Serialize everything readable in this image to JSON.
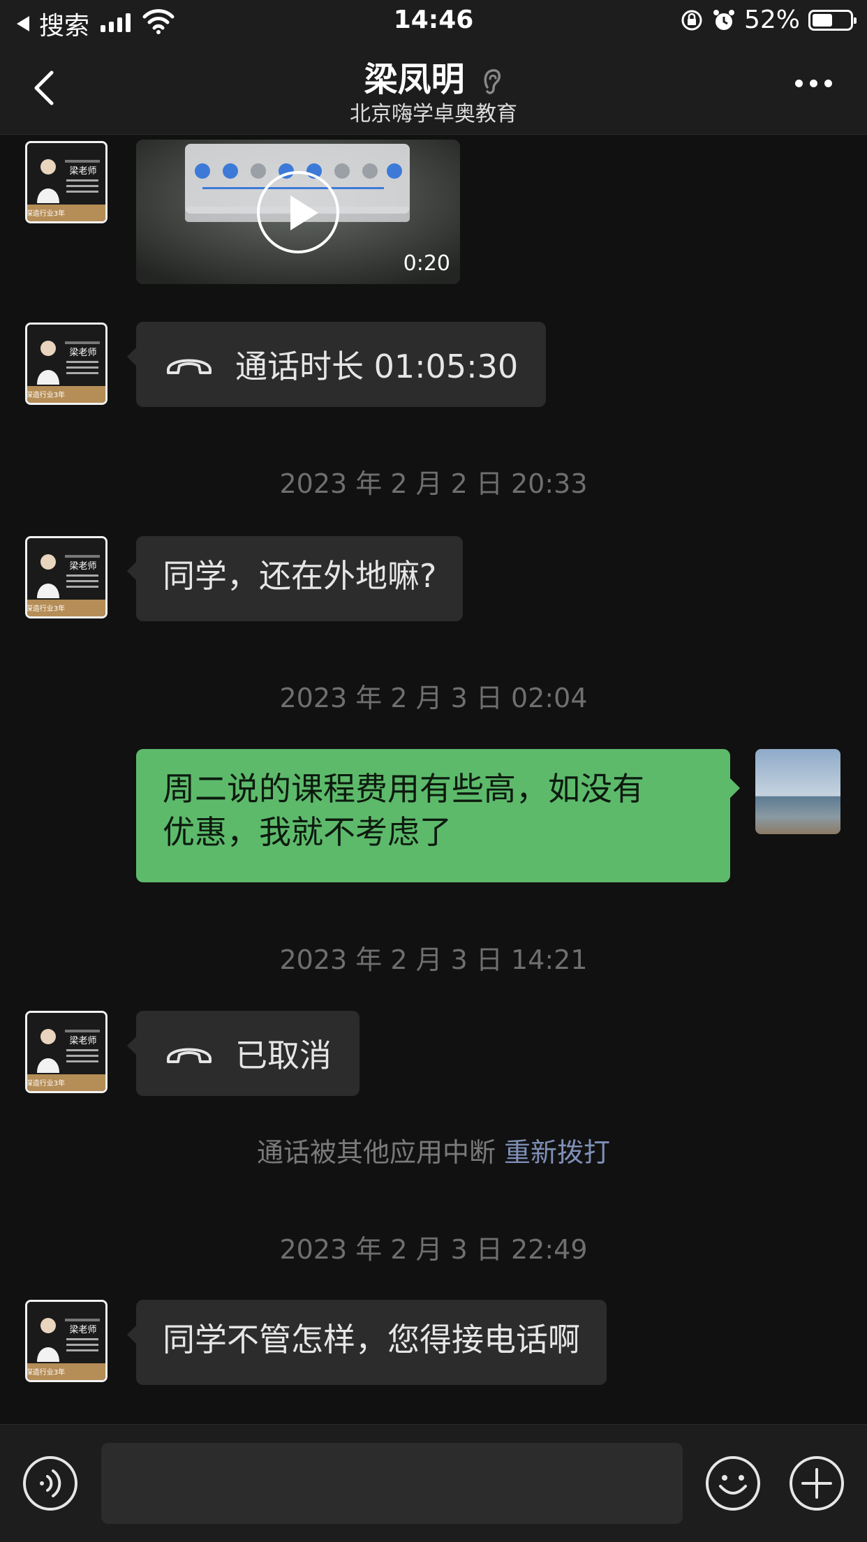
{
  "status_bar": {
    "back_app": "搜索",
    "time": "14:46",
    "battery": "52%"
  },
  "header": {
    "name": "梁凤明",
    "org": "北京嗨学卓奥教育"
  },
  "messages": {
    "video_duration": "0:20",
    "call1": "通话时长 01:05:30",
    "ts1": "2023 年 2 月 2 日 20:33",
    "msg1": "同学，还在外地嘛?",
    "ts2": "2023 年 2 月 3 日 02:04",
    "msg2_line1": "周二说的课程费用有些高，如没有",
    "msg2_line2": "优惠，我就不考虑了",
    "ts3": "2023 年 2 月 3 日 14:21",
    "call2": "已取消",
    "system_text": "通话被其他应用中断",
    "system_link": "重新拨打",
    "ts4": "2023 年 2 月 3 日 22:49",
    "msg3": "同学不管怎样，您得接电话啊"
  },
  "avatar": {
    "poster_title": "梁老师",
    "poster_line1": "嗨学教研学院",
    "poster_line2": "专注教育",
    "poster_footer": "深造行业3年"
  },
  "colors": {
    "green_bubble": "#5dba6b",
    "gray_bubble": "#2c2c2c",
    "link": "#7f90b8"
  },
  "icons": [
    "back-arrow-icon",
    "ear-icon",
    "more-icon",
    "phone-icon",
    "play-icon",
    "voice-icon",
    "emoji-icon",
    "plus-icon",
    "signal-icon",
    "wifi-icon",
    "lock-rotation-icon",
    "alarm-icon",
    "battery-icon"
  ]
}
